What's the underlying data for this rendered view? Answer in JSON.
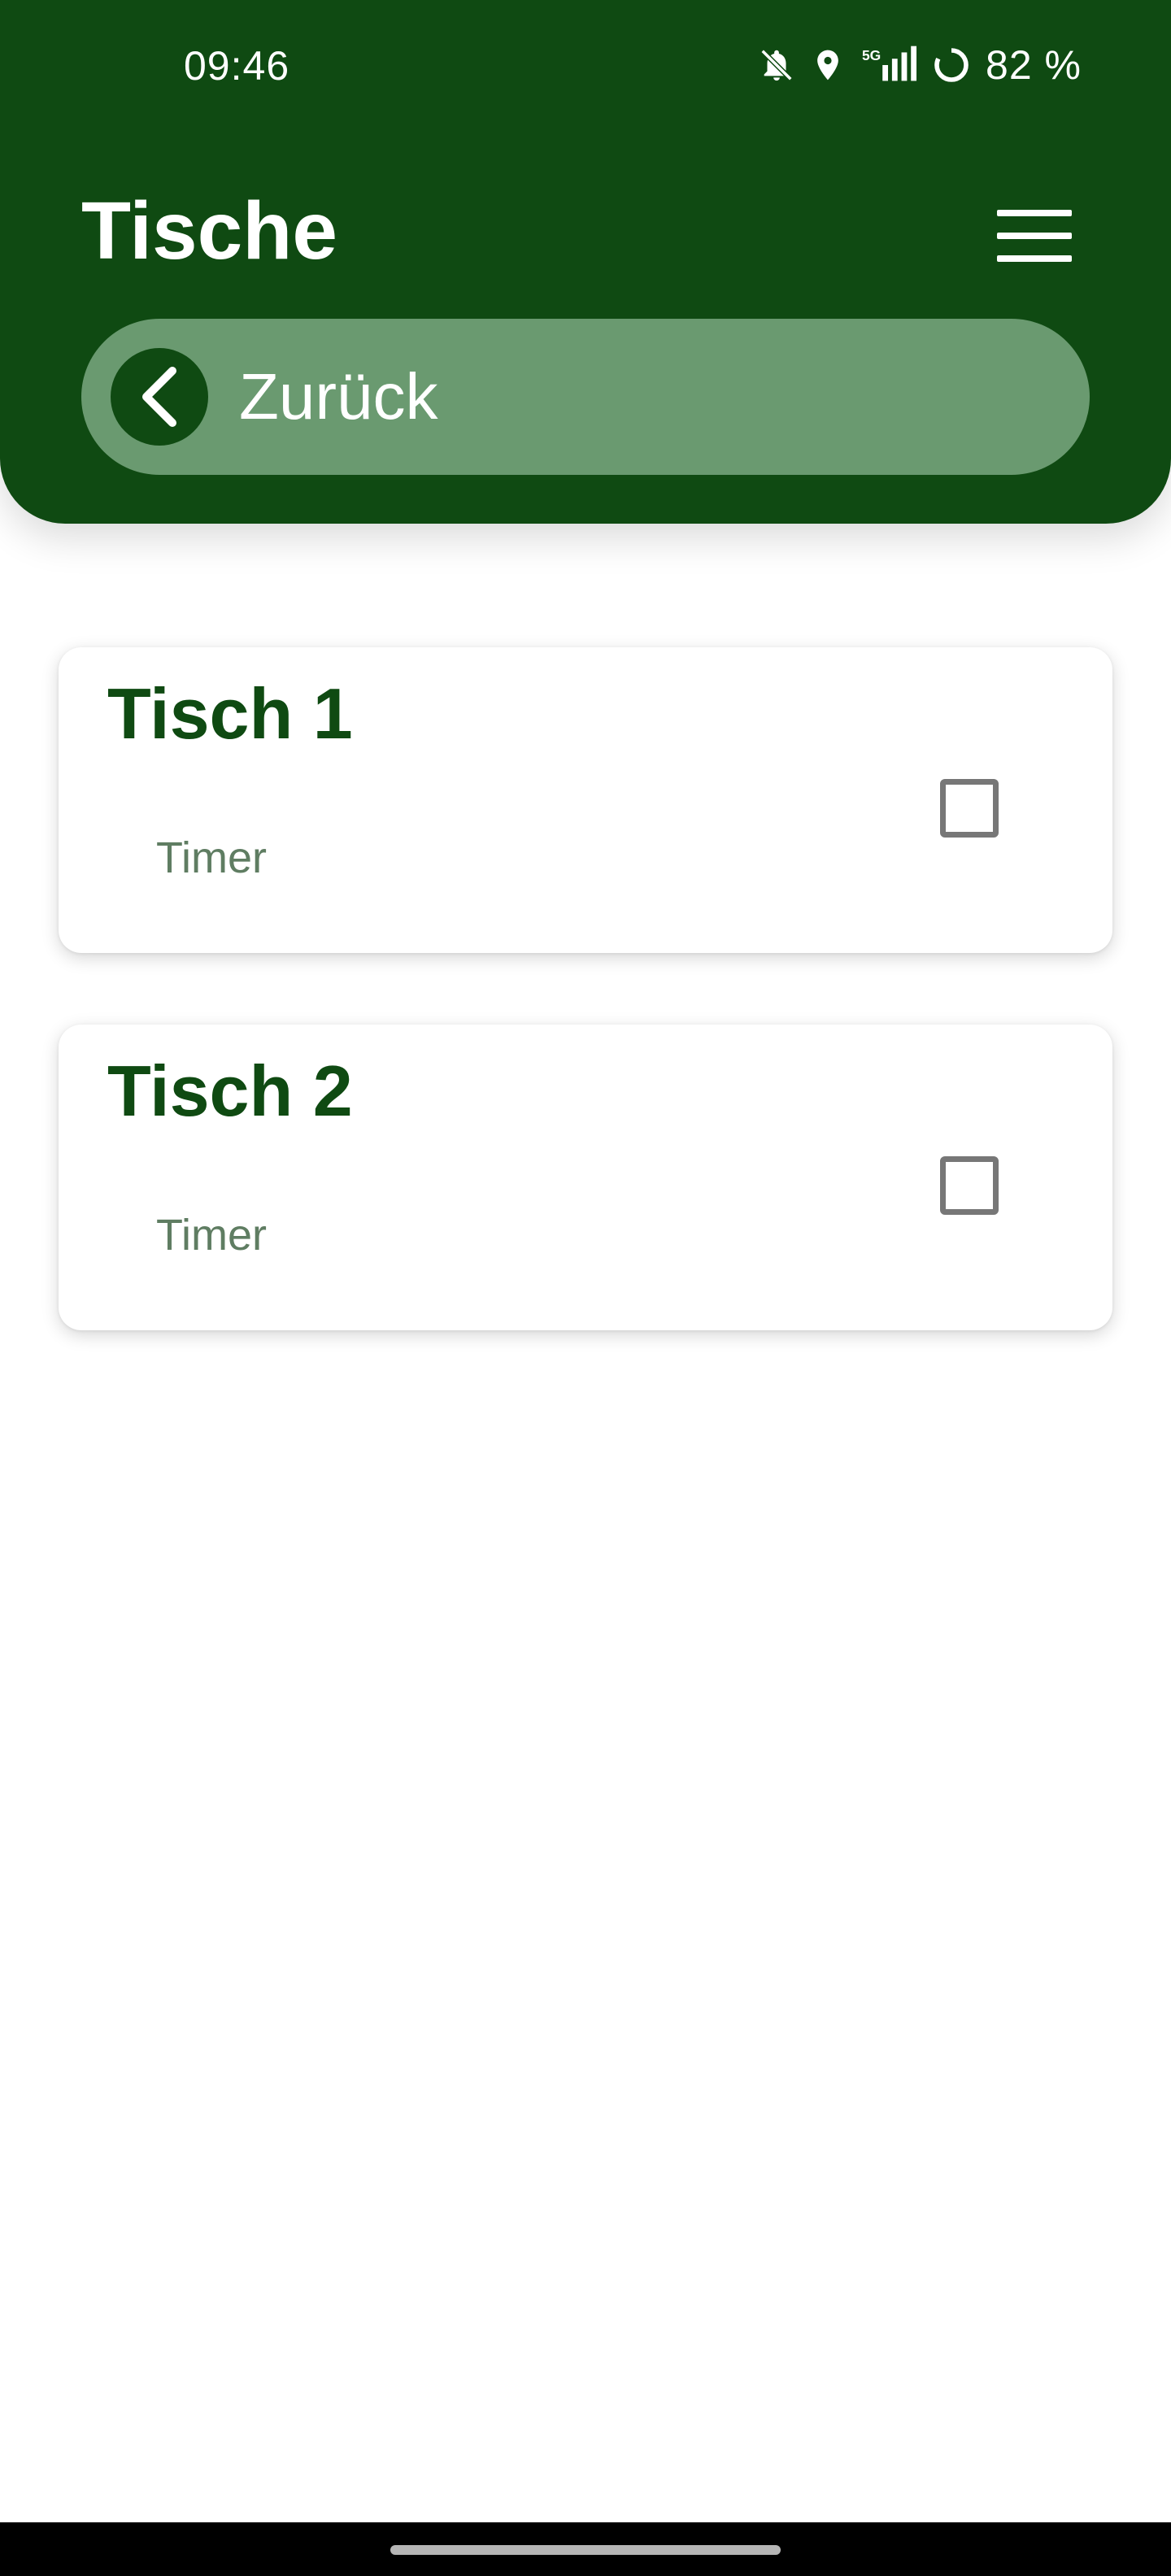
{
  "status_bar": {
    "time": "09:46",
    "network": "5G",
    "battery": "82 %",
    "icons": [
      "bell-off-icon",
      "location-pin-icon",
      "signal-icon",
      "battery-ring-icon"
    ]
  },
  "header": {
    "title": "Tische",
    "menu_icon": "hamburger-menu-icon",
    "back_label": "Zurück",
    "back_icon": "chevron-left-icon"
  },
  "tables": [
    {
      "title": "Tisch 1",
      "timer_label": "Timer",
      "checked": false
    },
    {
      "title": "Tisch 2",
      "timer_label": "Timer",
      "checked": false
    }
  ],
  "colors": {
    "primary": "#0f4a12",
    "pill": "#6a9a70",
    "timer_text": "#5f7d62",
    "checkbox_border": "#777777"
  }
}
